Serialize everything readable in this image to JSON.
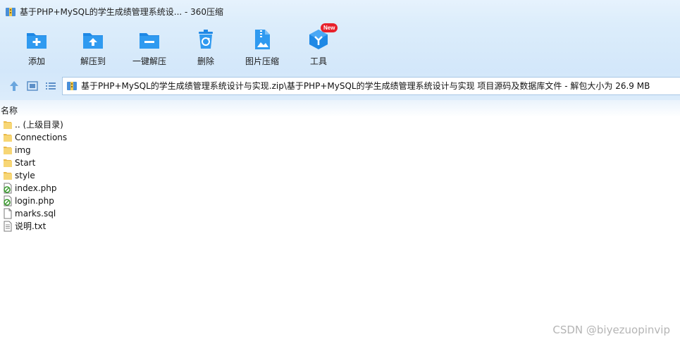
{
  "window": {
    "title": "基于PHP+MySQL的学生成绩管理系统设... - 360压缩",
    "app_icon": "zip-archive-icon"
  },
  "toolbar": {
    "buttons": [
      {
        "label": "添加",
        "icon": "folder-add-icon"
      },
      {
        "label": "解压到",
        "icon": "folder-extract-icon"
      },
      {
        "label": "一键解压",
        "icon": "folder-minus-icon"
      },
      {
        "label": "删除",
        "icon": "recycle-bin-icon"
      },
      {
        "label": "图片压缩",
        "icon": "image-compress-icon"
      },
      {
        "label": "工具",
        "icon": "tools-cube-icon",
        "badge": "New"
      }
    ]
  },
  "address": {
    "path": "基于PHP+MySQL的学生成绩管理系统设计与实现.zip\\基于PHP+MySQL的学生成绩管理系统设计与实现 项目源码及数据库文件 - 解包大小为 26.9 MB"
  },
  "list": {
    "column_name": "名称",
    "items": [
      {
        "name": ".. (上级目录)",
        "type": "folder"
      },
      {
        "name": "Connections",
        "type": "folder"
      },
      {
        "name": "img",
        "type": "folder"
      },
      {
        "name": "Start",
        "type": "folder"
      },
      {
        "name": "style",
        "type": "folder"
      },
      {
        "name": "index.php",
        "type": "php"
      },
      {
        "name": "login.php",
        "type": "php"
      },
      {
        "name": "marks.sql",
        "type": "file"
      },
      {
        "name": "说明.txt",
        "type": "txt"
      }
    ]
  },
  "watermark": "CSDN @biyezuopinvip",
  "colors": {
    "accent": "#1e88e5",
    "folder": "#f7d675",
    "badge": "#e8212b"
  }
}
